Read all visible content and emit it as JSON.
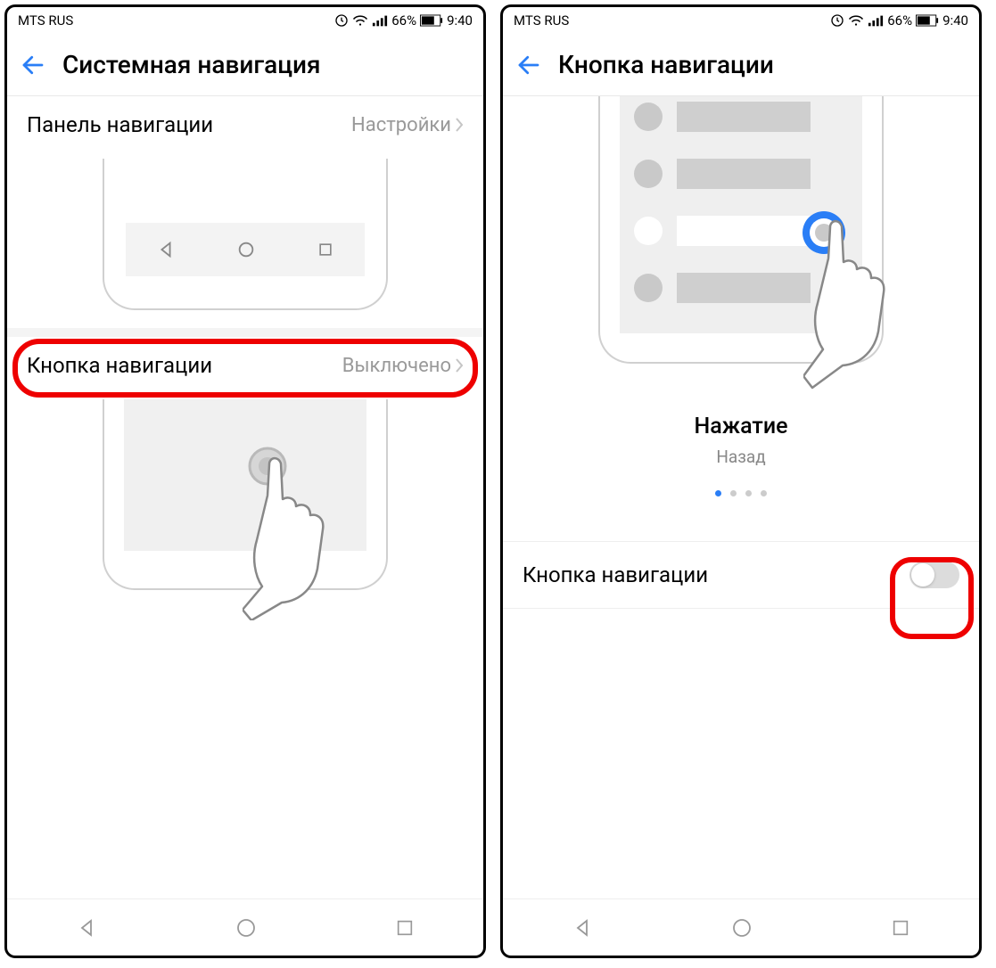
{
  "status": {
    "carrier": "MTS RUS",
    "battery_pct": "66%",
    "time": "9:40"
  },
  "screen1": {
    "title": "Системная навигация",
    "row1": {
      "label": "Панель навигации",
      "value": "Настройки"
    },
    "row2": {
      "label": "Кнопка навигации",
      "value": "Выключено"
    }
  },
  "screen2": {
    "title": "Кнопка навигации",
    "caption_title": "Нажатие",
    "caption_sub": "Назад",
    "toggle_label": "Кнопка навигации",
    "toggle_on": false,
    "page_dots": 4,
    "active_dot": 0
  }
}
